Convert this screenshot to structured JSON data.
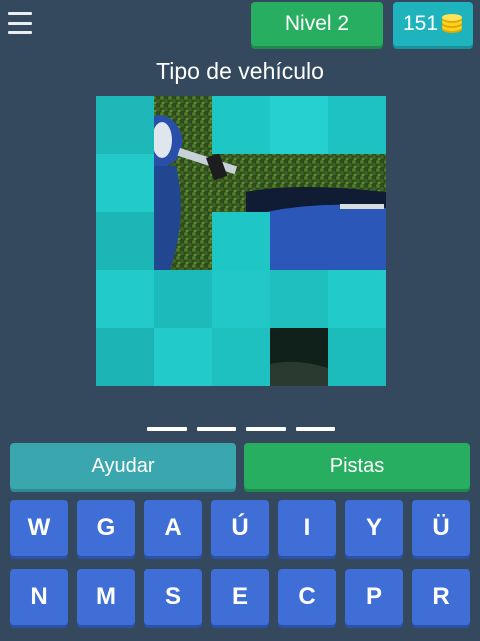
{
  "header": {
    "menu_icon": "hamburger-menu-icon",
    "level_label": "Nivel 2",
    "coins": "151",
    "coin_icon": "coin-stack-icon"
  },
  "puzzle": {
    "title": "Tipo de vehículo",
    "answer_length": 4,
    "image_subject": "blue scooter",
    "cover_color": "#1fc6c6",
    "grid": "5x5"
  },
  "actions": {
    "help_label": "Ayudar",
    "hints_label": "Pistas"
  },
  "keyboard": {
    "row1": [
      "W",
      "G",
      "A",
      "Ú",
      "I",
      "Y",
      "Ü"
    ],
    "row2": [
      "N",
      "M",
      "S",
      "E",
      "C",
      "P",
      "R"
    ]
  },
  "colors": {
    "background": "#34495e",
    "level_button": "#27ae60",
    "coins_button": "#1fb3bd",
    "help_button": "#3aa7af",
    "hints_button": "#27ae60",
    "key": "#3f6fd6"
  }
}
